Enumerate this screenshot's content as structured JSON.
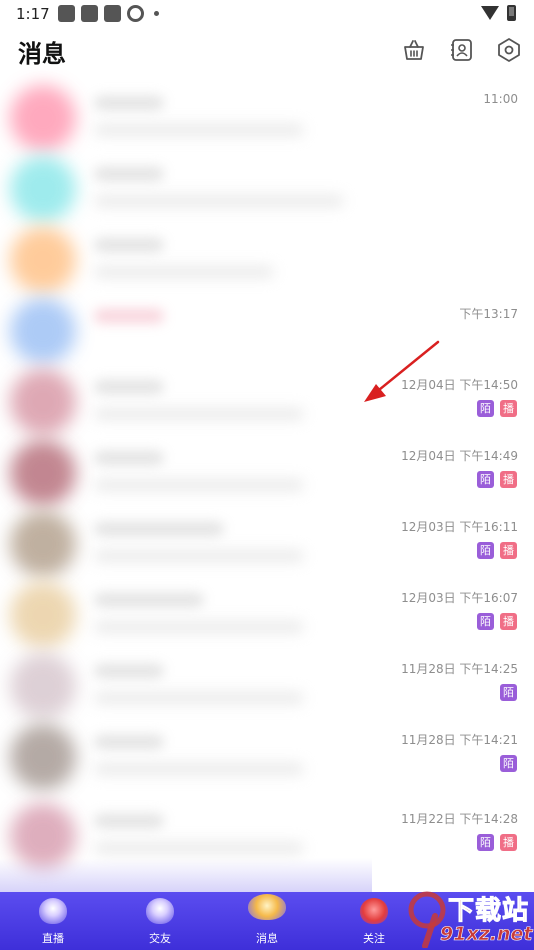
{
  "status_bar": {
    "time": "1:17"
  },
  "header": {
    "title": "消息",
    "actions": [
      {
        "name": "basket-icon"
      },
      {
        "name": "contacts-book-icon"
      },
      {
        "name": "hexagon-settings-icon"
      }
    ]
  },
  "messages": [
    {
      "time": "11:00",
      "tags": [],
      "avatar_color": "#ff9bb3"
    },
    {
      "time": "",
      "tags": [],
      "avatar_color": "#8ee8ea"
    },
    {
      "time": "",
      "tags": [],
      "avatar_color": "#ffc38a"
    },
    {
      "time": "下午13:17",
      "tags": [],
      "avatar_color": "#9fc2f5"
    },
    {
      "time": "12月04日 下午14:50",
      "tags": [
        "陌",
        "播"
      ],
      "avatar_color": "#d99aa8"
    },
    {
      "time": "12月04日 下午14:49",
      "tags": [
        "陌",
        "播"
      ],
      "avatar_color": "#b8727e"
    },
    {
      "time": "12月03日 下午16:11",
      "tags": [
        "陌",
        "播"
      ],
      "avatar_color": "#b5a390"
    },
    {
      "time": "12月03日 下午16:07",
      "tags": [
        "陌",
        "播"
      ],
      "avatar_color": "#ead0a4"
    },
    {
      "time": "11月28日 下午14:25",
      "tags": [
        "陌"
      ],
      "avatar_color": "#d8c8cf"
    },
    {
      "time": "11月28日 下午14:21",
      "tags": [
        "陌"
      ],
      "avatar_color": "#a89c96"
    },
    {
      "time": "11月22日 下午14:28",
      "tags": [
        "陌",
        "播"
      ],
      "avatar_color": "#d9a0b2"
    }
  ],
  "bottom_nav": {
    "items": [
      {
        "label": "直播",
        "icon": "live-icon"
      },
      {
        "label": "交友",
        "icon": "friends-icon"
      },
      {
        "label": "消息",
        "icon": "messages-icon",
        "active": true
      },
      {
        "label": "关注",
        "icon": "follow-icon"
      }
    ]
  },
  "watermark": {
    "top": "下载站",
    "bottom": "91xz.net"
  },
  "colors": {
    "tag_mo": "#9a5ed9",
    "tag_bo": "#f06e86",
    "nav_bg": "#4a3ce6",
    "annotation_arrow": "#d92020"
  }
}
